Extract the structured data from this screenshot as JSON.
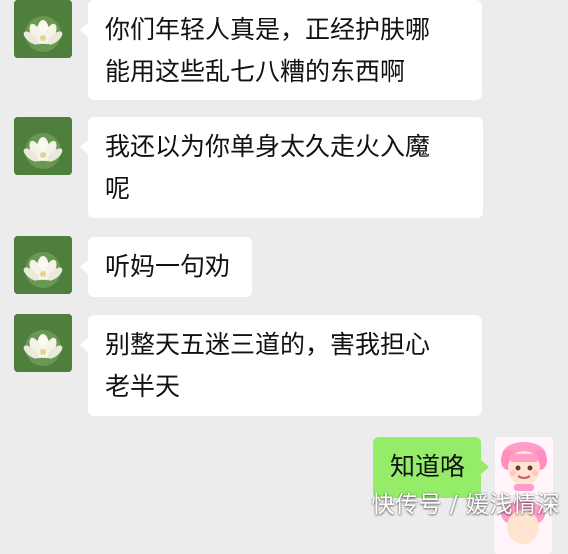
{
  "messages": [
    {
      "sender": "other",
      "lines": [
        "你们年轻人真是，正经护肤哪",
        "能用这些乱七八糟的东西啊"
      ]
    },
    {
      "sender": "other",
      "lines": [
        "我还以为你单身太久走火入魔",
        "呢"
      ]
    },
    {
      "sender": "other",
      "lines": [
        "听妈一句劝"
      ]
    },
    {
      "sender": "other",
      "lines": [
        "别整天五迷三道的，害我担心",
        "老半天"
      ]
    },
    {
      "sender": "me",
      "lines": [
        "知道咯"
      ]
    }
  ],
  "watermark": "快传号 / 媛浅情深",
  "colors": {
    "background": "#ececec",
    "incoming_bubble": "#ffffff",
    "outgoing_bubble": "#95ec69",
    "text": "#111111"
  },
  "icons": {
    "other_avatar": "lotus-avatar-icon",
    "me_avatar": "pink-cartoon-avatar-icon"
  }
}
